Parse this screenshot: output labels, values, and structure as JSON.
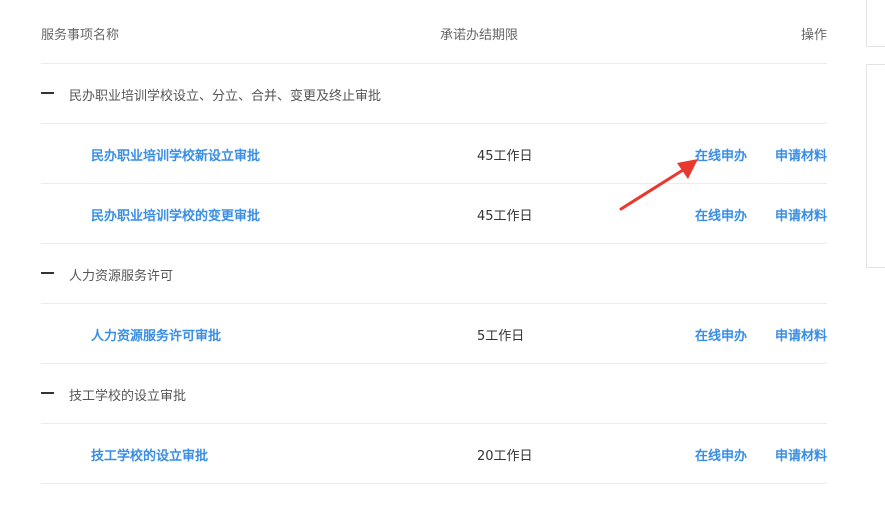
{
  "header": {
    "name_label": "服务事项名称",
    "limit_label": "承诺办结期限",
    "op_label": "操作"
  },
  "groups": [
    {
      "title": "民办职业培训学校设立、分立、合并、变更及终止审批",
      "items": [
        {
          "name": "民办职业培训学校新设立审批",
          "limit": "45工作日",
          "apply": "在线申办",
          "material": "申请材料"
        },
        {
          "name": "民办职业培训学校的变更审批",
          "limit": "45工作日",
          "apply": "在线申办",
          "material": "申请材料"
        }
      ]
    },
    {
      "title": "人力资源服务许可",
      "items": [
        {
          "name": "人力资源服务许可审批",
          "limit": "5工作日",
          "apply": "在线申办",
          "material": "申请材料"
        }
      ]
    },
    {
      "title": "技工学校的设立审批",
      "items": [
        {
          "name": "技工学校的设立审批",
          "limit": "20工作日",
          "apply": "在线申办",
          "material": "申请材料"
        }
      ]
    }
  ],
  "annotation": {
    "arrow_color": "#e8382f"
  }
}
